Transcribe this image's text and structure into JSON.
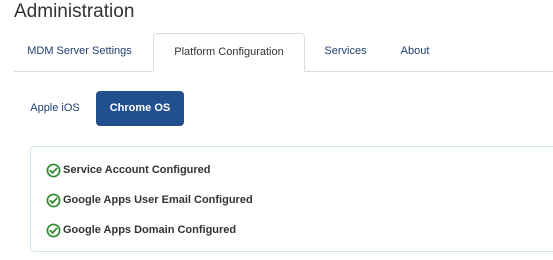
{
  "page": {
    "title": "Administration"
  },
  "tabs": [
    {
      "label": "MDM Server Settings",
      "active": false
    },
    {
      "label": "Platform Configuration",
      "active": true
    },
    {
      "label": "Services",
      "active": false
    },
    {
      "label": "About",
      "active": false
    }
  ],
  "platform_pills": [
    {
      "label": "Apple iOS",
      "active": false
    },
    {
      "label": "Chrome OS",
      "active": true
    }
  ],
  "status_items": [
    {
      "label": "Service Account Configured",
      "icon": "check-circle-icon",
      "status": "ok"
    },
    {
      "label": "Google Apps User Email Configured",
      "icon": "check-circle-icon",
      "status": "ok"
    },
    {
      "label": "Google Apps Domain Configured",
      "icon": "check-circle-icon",
      "status": "ok"
    }
  ],
  "colors": {
    "accent": "#22508f",
    "link": "#1f3f70",
    "success": "#2c8a2c",
    "panel_border": "#cfe3f0"
  }
}
